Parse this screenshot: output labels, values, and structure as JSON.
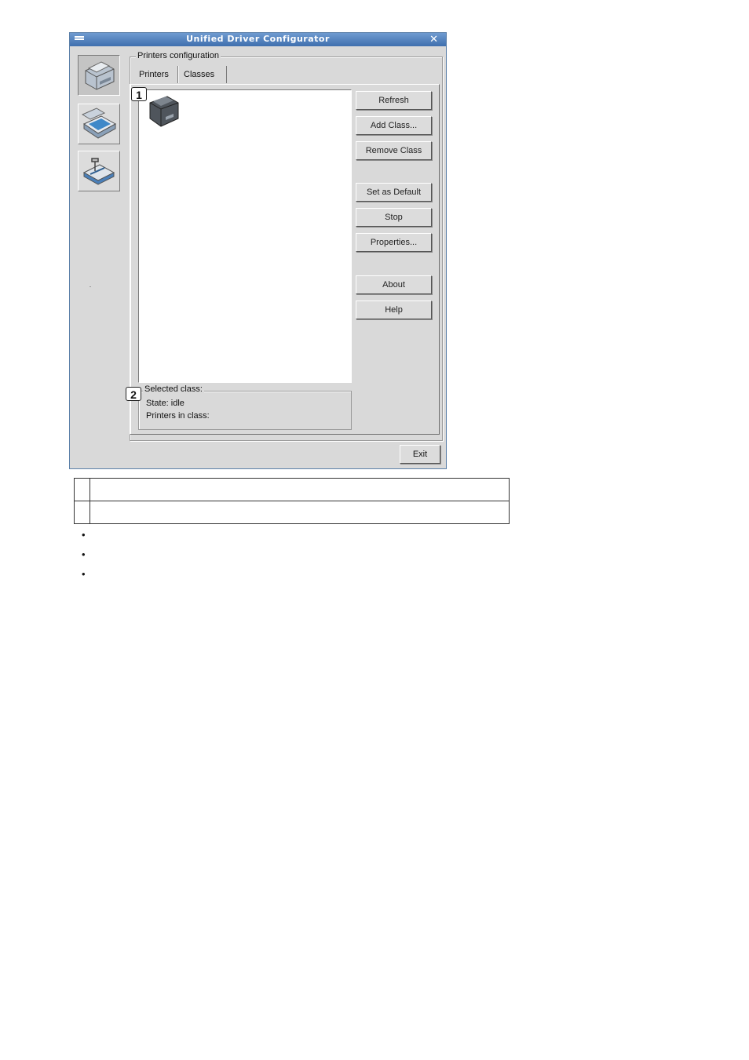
{
  "window": {
    "title": "Unified Driver Configurator",
    "close_glyph": "✕"
  },
  "sidebar": {
    "items": [
      {
        "name": "printers-config",
        "icon": "printer-icon",
        "active": true
      },
      {
        "name": "scanners-config",
        "icon": "scanner-icon",
        "active": false
      },
      {
        "name": "ports-config",
        "icon": "port-icon",
        "active": false
      }
    ]
  },
  "printers_configuration": {
    "group_label": "Printers configuration",
    "tabs": [
      {
        "label": "Printers",
        "active": false
      },
      {
        "label": "Classes",
        "active": true
      }
    ],
    "buttons": {
      "refresh": "Refresh",
      "add_class": "Add Class...",
      "remove_class": "Remove Class",
      "set_default": "Set as Default",
      "stop": "Stop",
      "properties": "Properties...",
      "about": "About",
      "help": "Help"
    },
    "selected_class": {
      "label": "Selected class:",
      "state": "State: idle",
      "printers_in_class": "Printers in class:"
    }
  },
  "callouts": [
    "1",
    "2"
  ],
  "exit_label": "Exit"
}
